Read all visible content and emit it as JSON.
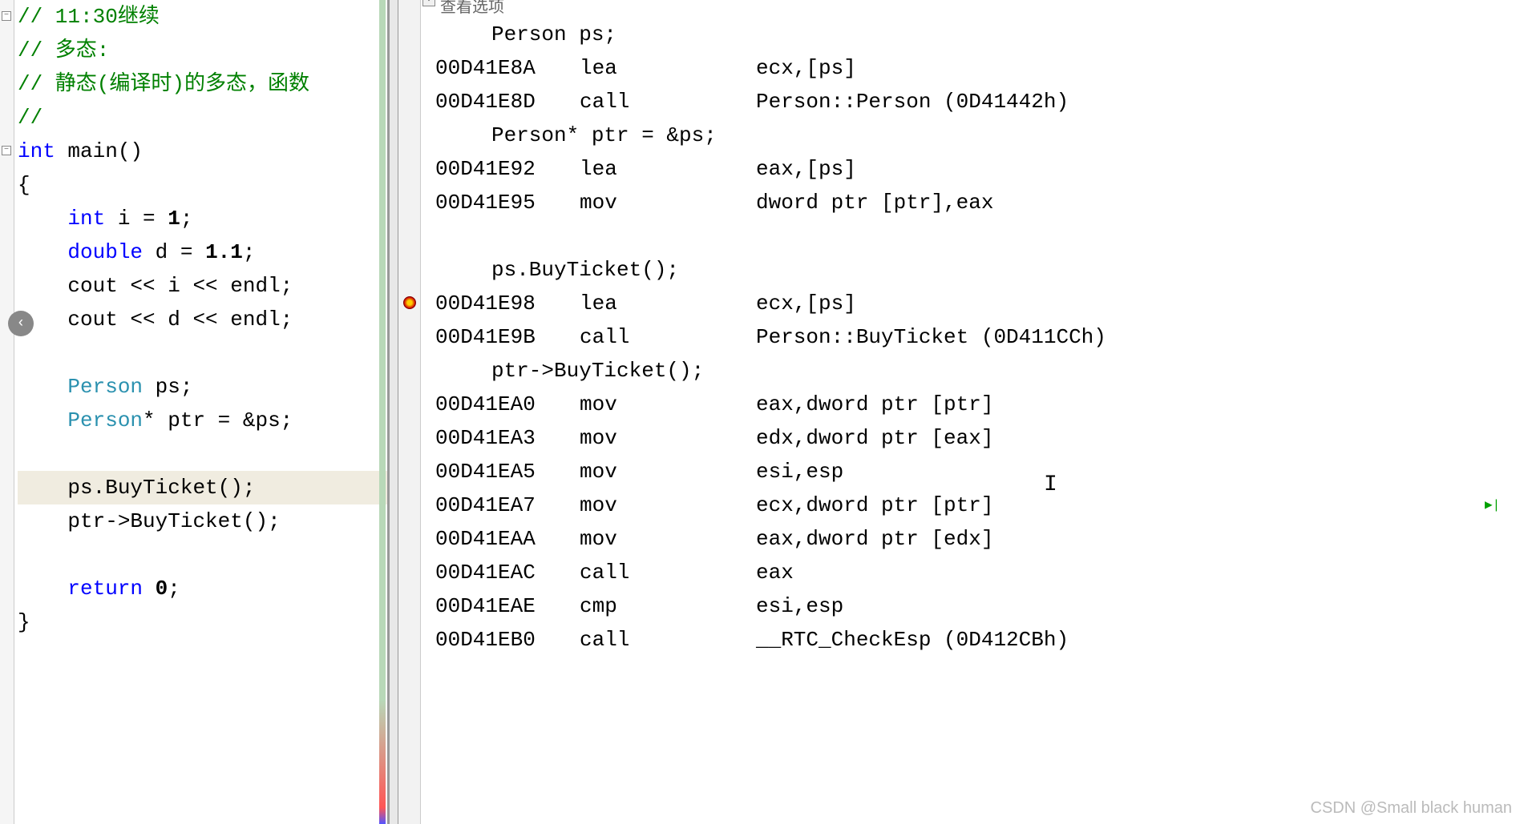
{
  "left": {
    "lines": [
      {
        "type": "comment",
        "text": "// 11:30继续",
        "fold": true
      },
      {
        "type": "comment",
        "text": "// 多态:"
      },
      {
        "type": "comment",
        "text": "// 静态(编译时)的多态，函数"
      },
      {
        "type": "comment",
        "text": "//"
      },
      {
        "type": "code",
        "fold": true,
        "tokens": [
          {
            "c": "keyword",
            "t": "int"
          },
          {
            "c": "text",
            "t": " main()"
          }
        ]
      },
      {
        "type": "code",
        "tokens": [
          {
            "c": "text",
            "t": "{"
          }
        ]
      },
      {
        "type": "code",
        "indent": "    ",
        "tokens": [
          {
            "c": "keyword",
            "t": "int"
          },
          {
            "c": "text",
            "t": " i = "
          },
          {
            "c": "number",
            "t": "1"
          },
          {
            "c": "text",
            "t": ";"
          }
        ]
      },
      {
        "type": "code",
        "indent": "    ",
        "tokens": [
          {
            "c": "keyword",
            "t": "double"
          },
          {
            "c": "text",
            "t": " d = "
          },
          {
            "c": "number",
            "t": "1.1"
          },
          {
            "c": "text",
            "t": ";"
          }
        ]
      },
      {
        "type": "code",
        "indent": "    ",
        "tokens": [
          {
            "c": "text",
            "t": "cout << i << endl;"
          }
        ]
      },
      {
        "type": "code",
        "indent": "    ",
        "tokens": [
          {
            "c": "text",
            "t": "cout << d << endl;"
          }
        ]
      },
      {
        "type": "blank"
      },
      {
        "type": "code",
        "indent": "    ",
        "tokens": [
          {
            "c": "type",
            "t": "Person"
          },
          {
            "c": "text",
            "t": " ps;"
          }
        ]
      },
      {
        "type": "code",
        "indent": "    ",
        "tokens": [
          {
            "c": "type",
            "t": "Person"
          },
          {
            "c": "text",
            "t": "* ptr = &ps;"
          }
        ]
      },
      {
        "type": "blank"
      },
      {
        "type": "code",
        "indent": "    ",
        "highlight": true,
        "tokens": [
          {
            "c": "text",
            "t": "ps.BuyTicket();"
          }
        ]
      },
      {
        "type": "code",
        "indent": "    ",
        "tokens": [
          {
            "c": "text",
            "t": "ptr->BuyTicket();"
          }
        ]
      },
      {
        "type": "blank"
      },
      {
        "type": "code",
        "indent": "    ",
        "tokens": [
          {
            "c": "keyword",
            "t": "return"
          },
          {
            "c": "text",
            "t": " "
          },
          {
            "c": "number",
            "t": "0"
          },
          {
            "c": "text",
            "t": ";"
          }
        ]
      },
      {
        "type": "code",
        "tokens": [
          {
            "c": "text",
            "t": "}"
          }
        ]
      }
    ]
  },
  "right": {
    "header": "查看选项",
    "lines": [
      {
        "src": "Person ps;"
      },
      {
        "addr": "00D41E8A",
        "op": "lea",
        "operand": "ecx,[ps]"
      },
      {
        "addr": "00D41E8D",
        "op": "call",
        "operand": "Person::Person (0D41442h)"
      },
      {
        "src": "Person* ptr = &ps;"
      },
      {
        "addr": "00D41E92",
        "op": "lea",
        "operand": "eax,[ps]"
      },
      {
        "addr": "00D41E95",
        "op": "mov",
        "operand": "dword ptr [ptr],eax"
      },
      {
        "blank": true
      },
      {
        "src": "ps.BuyTicket();"
      },
      {
        "addr": "00D41E98",
        "op": "lea",
        "operand": "ecx,[ps]",
        "bp": true
      },
      {
        "addr": "00D41E9B",
        "op": "call",
        "operand": "Person::BuyTicket (0D411CCh)"
      },
      {
        "src": "ptr->BuyTicket();"
      },
      {
        "addr": "00D41EA0",
        "op": "mov",
        "operand": "eax,dword ptr [ptr]"
      },
      {
        "addr": "00D41EA3",
        "op": "mov",
        "operand": "edx,dword ptr [eax]"
      },
      {
        "addr": "00D41EA5",
        "op": "mov",
        "operand": "esi,esp"
      },
      {
        "addr": "00D41EA7",
        "op": "mov",
        "operand": "ecx,dword ptr [ptr]",
        "cursor": true,
        "runmark": true
      },
      {
        "addr": "00D41EAA",
        "op": "mov",
        "operand": "eax,dword ptr [edx]"
      },
      {
        "addr": "00D41EAC",
        "op": "call",
        "operand": "eax"
      },
      {
        "addr": "00D41EAE",
        "op": "cmp",
        "operand": "esi,esp"
      },
      {
        "addr": "00D41EB0",
        "op": "call",
        "operand": "__RTC_CheckEsp (0D412CBh)"
      }
    ]
  },
  "watermark": "CSDN @Small black human"
}
